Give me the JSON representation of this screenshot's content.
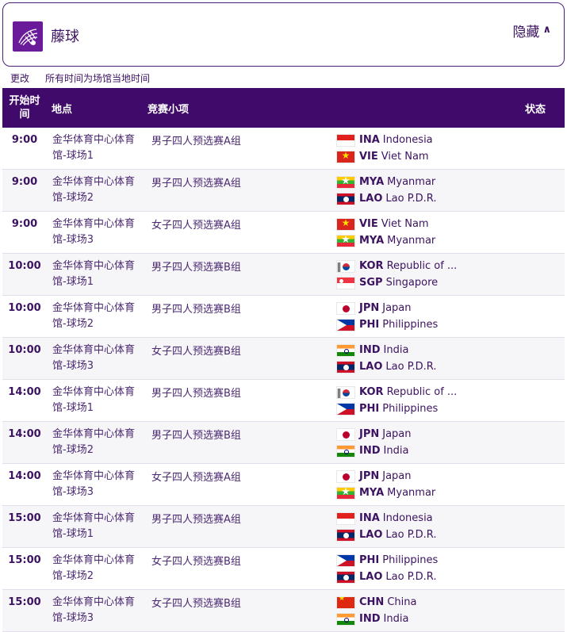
{
  "header": {
    "title": "藤球",
    "icon": "sepaktakraw-icon",
    "toggle_label": "隐藏"
  },
  "subbar": {
    "change_label": "更改",
    "tz_note": "所有时间为场馆当地时间"
  },
  "columns": {
    "time": "开始时间",
    "venue": "地点",
    "event": "竞赛小项",
    "status": "状态"
  },
  "rows": [
    {
      "time": "9:00",
      "venue": "金华体育中心体育馆-球场1",
      "event": "男子四人预选赛A组",
      "teams": [
        {
          "code": "INA",
          "name": "Indonesia"
        },
        {
          "code": "VIE",
          "name": "Viet Nam"
        }
      ]
    },
    {
      "time": "9:00",
      "venue": "金华体育中心体育馆-球场2",
      "event": "男子四人预选赛A组",
      "teams": [
        {
          "code": "MYA",
          "name": "Myanmar"
        },
        {
          "code": "LAO",
          "name": "Lao P.D.R."
        }
      ]
    },
    {
      "time": "9:00",
      "venue": "金华体育中心体育馆-球场3",
      "event": "女子四人预选赛A组",
      "teams": [
        {
          "code": "VIE",
          "name": "Viet Nam"
        },
        {
          "code": "MYA",
          "name": "Myanmar"
        }
      ]
    },
    {
      "time": "10:00",
      "venue": "金华体育中心体育馆-球场1",
      "event": "男子四人预选赛B组",
      "teams": [
        {
          "code": "KOR",
          "name": "Republic of ..."
        },
        {
          "code": "SGP",
          "name": "Singapore"
        }
      ]
    },
    {
      "time": "10:00",
      "venue": "金华体育中心体育馆-球场2",
      "event": "男子四人预选赛B组",
      "teams": [
        {
          "code": "JPN",
          "name": "Japan"
        },
        {
          "code": "PHI",
          "name": "Philippines"
        }
      ]
    },
    {
      "time": "10:00",
      "venue": "金华体育中心体育馆-球场3",
      "event": "女子四人预选赛B组",
      "teams": [
        {
          "code": "IND",
          "name": "India"
        },
        {
          "code": "LAO",
          "name": "Lao P.D.R."
        }
      ]
    },
    {
      "time": "14:00",
      "venue": "金华体育中心体育馆-球场1",
      "event": "男子四人预选赛B组",
      "teams": [
        {
          "code": "KOR",
          "name": "Republic of ..."
        },
        {
          "code": "PHI",
          "name": "Philippines"
        }
      ]
    },
    {
      "time": "14:00",
      "venue": "金华体育中心体育馆-球场2",
      "event": "男子四人预选赛B组",
      "teams": [
        {
          "code": "JPN",
          "name": "Japan"
        },
        {
          "code": "IND",
          "name": "India"
        }
      ]
    },
    {
      "time": "14:00",
      "venue": "金华体育中心体育馆-球场3",
      "event": "女子四人预选赛A组",
      "teams": [
        {
          "code": "JPN",
          "name": "Japan"
        },
        {
          "code": "MYA",
          "name": "Myanmar"
        }
      ]
    },
    {
      "time": "15:00",
      "venue": "金华体育中心体育馆-球场1",
      "event": "男子四人预选赛A组",
      "teams": [
        {
          "code": "INA",
          "name": "Indonesia"
        },
        {
          "code": "LAO",
          "name": "Lao P.D.R."
        }
      ]
    },
    {
      "time": "15:00",
      "venue": "金华体育中心体育馆-球场2",
      "event": "女子四人预选赛B组",
      "teams": [
        {
          "code": "PHI",
          "name": "Philippines"
        },
        {
          "code": "LAO",
          "name": "Lao P.D.R."
        }
      ]
    },
    {
      "time": "15:00",
      "venue": "金华体育中心体育馆-球场3",
      "event": "女子四人预选赛B组",
      "teams": [
        {
          "code": "CHN",
          "name": "China"
        },
        {
          "code": "IND",
          "name": "India"
        }
      ]
    }
  ],
  "colors": {
    "header_bg": "#3f0a6a",
    "text": "#3c1361",
    "icon_bg": "#6a1b9a",
    "row_alt": "#f6f5f8"
  }
}
